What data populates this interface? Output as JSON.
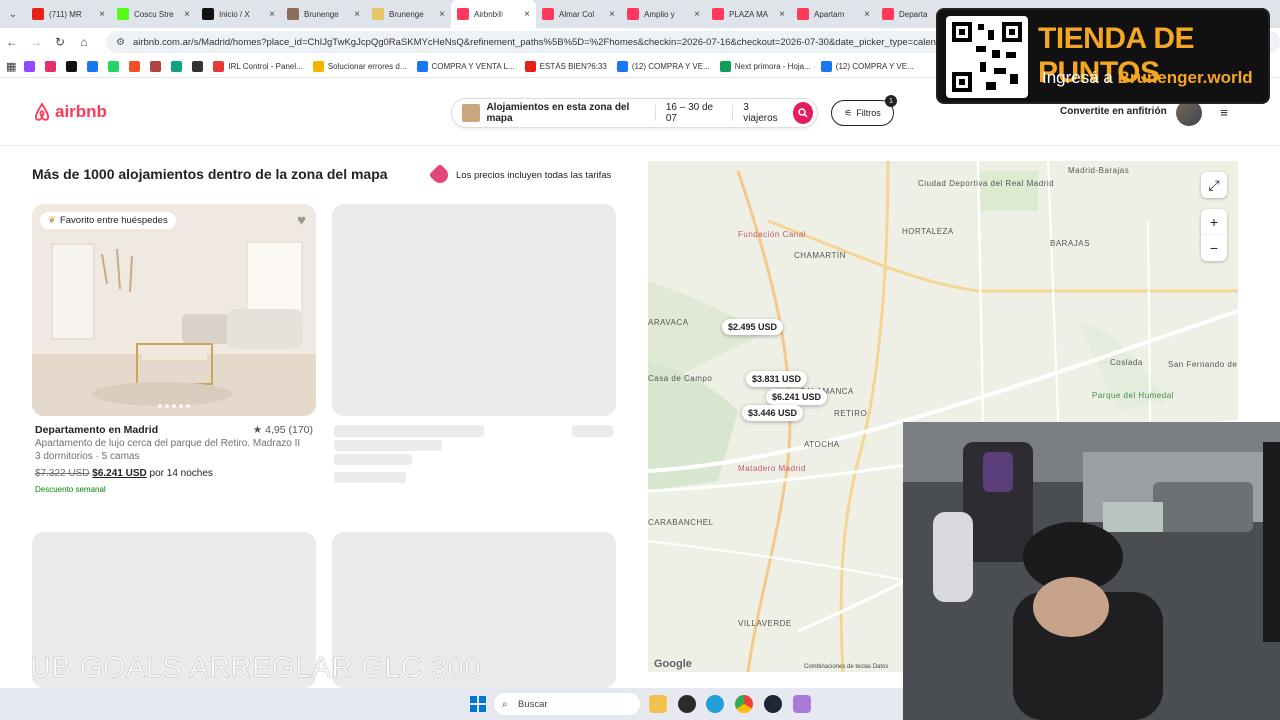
{
  "browser": {
    "tabs": [
      {
        "label": "(711) MR",
        "color": "#e62117",
        "active": false
      },
      {
        "label": "Coscu Stre",
        "color": "#53fc18",
        "active": false
      },
      {
        "label": "Inicio / X",
        "color": "#111111",
        "active": false
      },
      {
        "label": "Brunenge",
        "color": "#8a6d5a",
        "active": false
      },
      {
        "label": "Brunenge",
        "color": "#e8c56a",
        "active": false
      },
      {
        "label": "Airbnb®",
        "color": "#ff385c",
        "active": true
      },
      {
        "label": "Almar Col",
        "color": "#ff385c",
        "active": false
      },
      {
        "label": "Amplio y",
        "color": "#ff385c",
        "active": false
      },
      {
        "label": "PLAZA MA",
        "color": "#ff385c",
        "active": false
      },
      {
        "label": "Apartam",
        "color": "#ff385c",
        "active": false
      },
      {
        "label": "Departa",
        "color": "#ff385c",
        "active": false
      }
    ],
    "url": "airbnb.com.ar/s/Madrid/homes?place_id=ChIJgTwKgJcpQg0RaSKMYcHeNsQ&refinement_paths%5B%5D=%2Fhomes&checkin=2026-07-16&checkout=2026-07-30&date_picker_type=calendar&ad",
    "bookmarks": [
      {
        "label": "",
        "color": "#9146ff"
      },
      {
        "label": "",
        "color": "#e1306c"
      },
      {
        "label": "",
        "color": "#111111"
      },
      {
        "label": "",
        "color": "#1877f2"
      },
      {
        "label": "",
        "color": "#25d366"
      },
      {
        "label": "",
        "color": "#f25022"
      },
      {
        "label": "",
        "color": "#b0433f"
      },
      {
        "label": "",
        "color": "#10a37f"
      },
      {
        "label": "",
        "color": "#333333"
      },
      {
        "label": "IRL Control - Panel...",
        "color": "#e53935"
      },
      {
        "label": "Solucionar errores d...",
        "color": "#f4b400"
      },
      {
        "label": "COMPRA Y VENTA L...",
        "color": "#1877f2"
      },
      {
        "label": "ESTÁS BIEN?6:33",
        "color": "#e62117"
      },
      {
        "label": "(12) COMPRA Y VE...",
        "color": "#1877f2"
      },
      {
        "label": "Next primora - Hoja...",
        "color": "#0f9d58"
      },
      {
        "label": "(12) COMPRA Y VE...",
        "color": "#1877f2"
      }
    ]
  },
  "header": {
    "logo": "airbnb",
    "search_place": "Alojamientos en esta zona del mapa",
    "search_dates": "16 – 30 de 07",
    "search_guests": "3 viajeros",
    "filters_label": "Filtros",
    "filters_count": "1",
    "host_link": "Convertite en anfitrión",
    "accent": "#ff385c"
  },
  "results": {
    "title": "Más de 1000 alojamientos dentro de la zona del mapa",
    "price_note": "Los precios incluyen todas las tarifas"
  },
  "listing": {
    "badge": "Favorito entre huéspedes",
    "title": "Departamento en Madrid",
    "rating": "★ 4,95 (170)",
    "description": "Apartamento de lujo cerca del parque del Retiro. Madrazo II",
    "details": "3 dormitorios · 5 camas",
    "old_price": "$7.322 USD",
    "new_price": "$6.241 USD",
    "price_suffix": "por 14 noches",
    "discount": "Descuento semanal"
  },
  "map": {
    "labels": [
      "Ciudad Deportiva del Real Madrid",
      "Madrid-Barajas",
      "HORTALEZA",
      "BARAJAS",
      "Fundación Canal",
      "CHAMARTÍN",
      "ARAVACA",
      "SALAMANCA",
      "Coslada",
      "San Fernando de Henares",
      "Parque del Humedal",
      "RETIRO",
      "Casa de Campo",
      "ATOCHA",
      "Matadero Madrid",
      "CARABANCHEL",
      "VILLAVERDE"
    ],
    "pins": [
      "$2.495 USD",
      "$3.831 USD",
      "$6.241 USD",
      "$3.446 USD"
    ],
    "google": "Google",
    "footer": "Combinaciones de teclas   Datos"
  },
  "overlay": {
    "promo_title": "TIENDA DE PUNTOS",
    "promo_sub_prefix": "Ingresá a",
    "promo_sub_site": "Brunenger.world",
    "ticker": "UB GOALS ARREGLAR GLC  300"
  },
  "taskbar": {
    "search_label": "Buscar"
  }
}
